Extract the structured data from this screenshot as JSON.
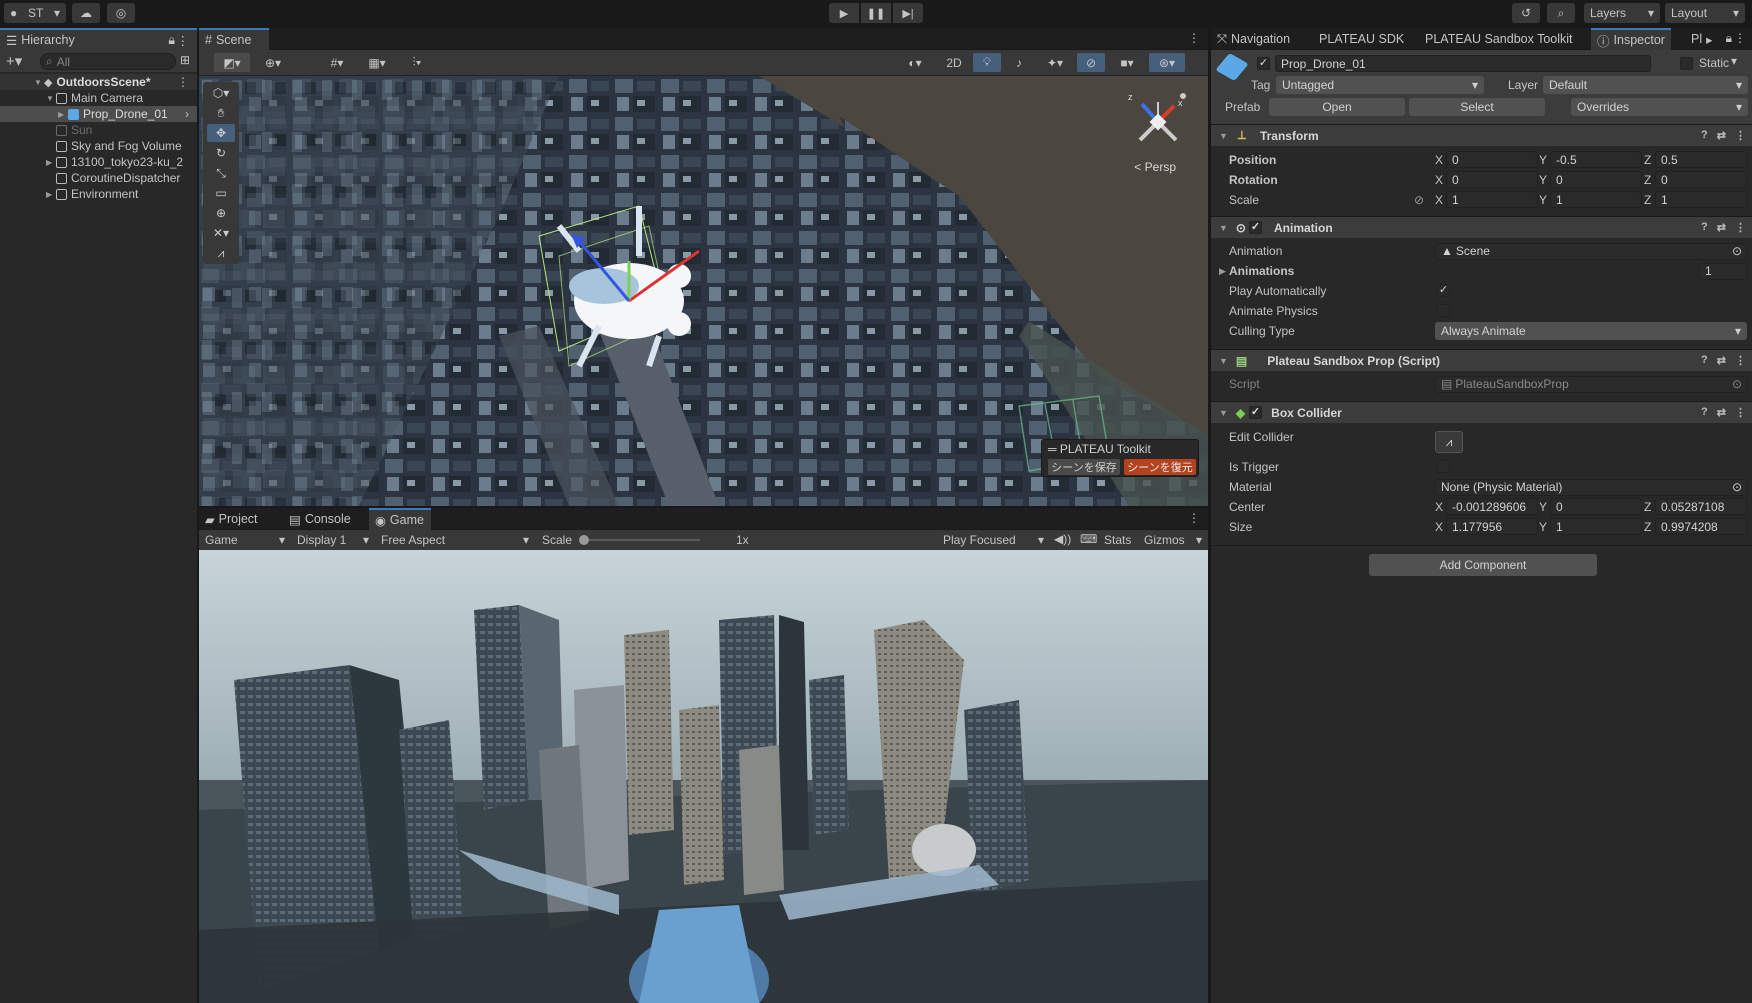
{
  "toolbar": {
    "account": "ST",
    "layers": "Layers",
    "layout": "Layout"
  },
  "hierarchy": {
    "tab": "Hierarchy",
    "search_placeholder": "All",
    "scene": "OutdoorsScene*",
    "items": [
      {
        "label": "Main Camera",
        "indent": 1,
        "expanded": true
      },
      {
        "label": "Prop_Drone_01",
        "indent": 2,
        "selected": true
      },
      {
        "label": "Sun",
        "indent": 1,
        "disabled": true
      },
      {
        "label": "Sky and Fog Volume",
        "indent": 1
      },
      {
        "label": "13100_tokyo23-ku_2",
        "indent": 1,
        "collapsed": true
      },
      {
        "label": "CoroutineDispatcher",
        "indent": 1
      },
      {
        "label": "Environment",
        "indent": 1,
        "collapsed": true
      }
    ]
  },
  "scene": {
    "tab": "Scene",
    "mode_2d": "2D",
    "persp": "< Persp",
    "toolkit_title": "PLATEAU Toolkit",
    "save_scene": "シーンを保存",
    "restore_scene": "シーンを復元",
    "gizmo_z": "z",
    "gizmo_x": "x"
  },
  "bottom": {
    "tabs": [
      "Project",
      "Console",
      "Game"
    ],
    "game_dropdown": "Game",
    "display": "Display 1",
    "aspect": "Free Aspect",
    "scale_label": "Scale",
    "scale_value": "1x",
    "play_focused": "Play Focused",
    "stats": "Stats",
    "gizmos": "Gizmos"
  },
  "inspector": {
    "tabs": [
      "Navigation",
      "PLATEAU SDK",
      "PLATEAU Sandbox Toolkit",
      "Inspector",
      "Pl"
    ],
    "object_name": "Prop_Drone_01",
    "static": "Static",
    "tag_label": "Tag",
    "tag_value": "Untagged",
    "layer_label": "Layer",
    "layer_value": "Default",
    "prefab_label": "Prefab",
    "open": "Open",
    "select": "Select",
    "overrides": "Overrides",
    "transform": {
      "title": "Transform",
      "position_label": "Position",
      "rotation_label": "Rotation",
      "scale_label": "Scale",
      "position": [
        "0",
        "-0.5",
        "0.5"
      ],
      "rotation": [
        "0",
        "0",
        "0"
      ],
      "scale": [
        "1",
        "1",
        "1"
      ]
    },
    "animation": {
      "title": "Animation",
      "animation_label": "Animation",
      "animation_value": "Scene",
      "animations_label": "Animations",
      "animations_count": "1",
      "play_auto": "Play Automatically",
      "animate_physics": "Animate Physics",
      "culling_label": "Culling Type",
      "culling_value": "Always Animate"
    },
    "script_comp": {
      "title": "Plateau Sandbox Prop (Script)",
      "script_label": "Script",
      "script_value": "PlateauSandboxProp"
    },
    "box_collider": {
      "title": "Box Collider",
      "edit_collider": "Edit Collider",
      "is_trigger": "Is Trigger",
      "material_label": "Material",
      "material_value": "None (Physic Material)",
      "center_label": "Center",
      "center": [
        "-0.001289606",
        "0",
        "0.05287108"
      ],
      "size_label": "Size",
      "size": [
        "1.177956",
        "1",
        "0.9974208"
      ]
    },
    "add_component": "Add Component",
    "axes": [
      "X",
      "Y",
      "Z"
    ]
  },
  "colors": {
    "accent": "#3a79bb",
    "restore": "#b5421f",
    "panel": "#282828"
  }
}
